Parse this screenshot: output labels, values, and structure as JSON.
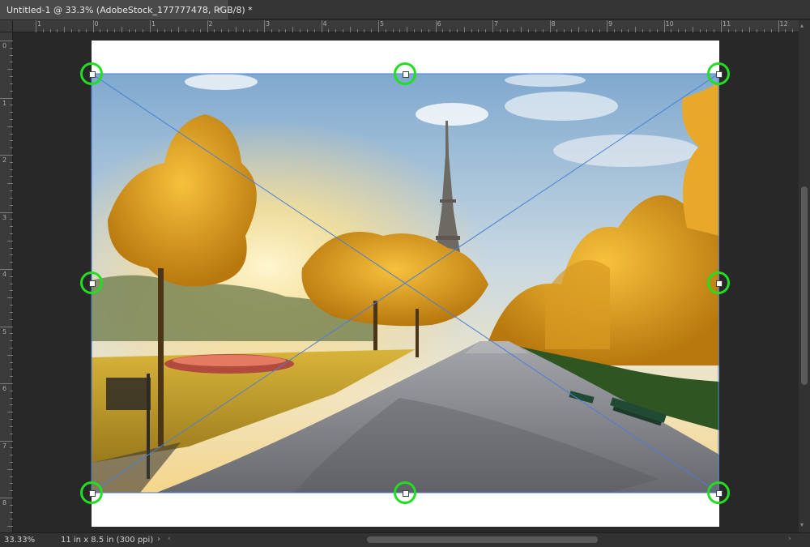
{
  "document_tab": {
    "title": "Untitled-1 @ 33.3% (AdobeStock_177777478, RGB/8) *",
    "close_glyph": "×"
  },
  "ruler": {
    "horizontal_labels": [
      "1",
      "0",
      "1",
      "2",
      "3",
      "4",
      "5",
      "6",
      "7",
      "8",
      "9",
      "10",
      "11",
      "12"
    ],
    "vertical_labels": [
      "0",
      "1",
      "2",
      "3",
      "4",
      "5",
      "6",
      "7",
      "8"
    ]
  },
  "canvas": {
    "image_name": "AdobeStock_177777478",
    "scene_description_icon": "photo-eiffel-tower-park",
    "transform_handle_color": "#22dd22",
    "bounding_box_color": "#4a7fd6"
  },
  "status_bar": {
    "zoom": "33.33%",
    "document_size": "11 in x 8.5 in (300 ppi)",
    "expand_glyph": "›"
  },
  "scrollbar": {
    "left_arrow": "‹",
    "right_arrow": "›",
    "up_arrow": "▴",
    "down_arrow": "▾"
  }
}
